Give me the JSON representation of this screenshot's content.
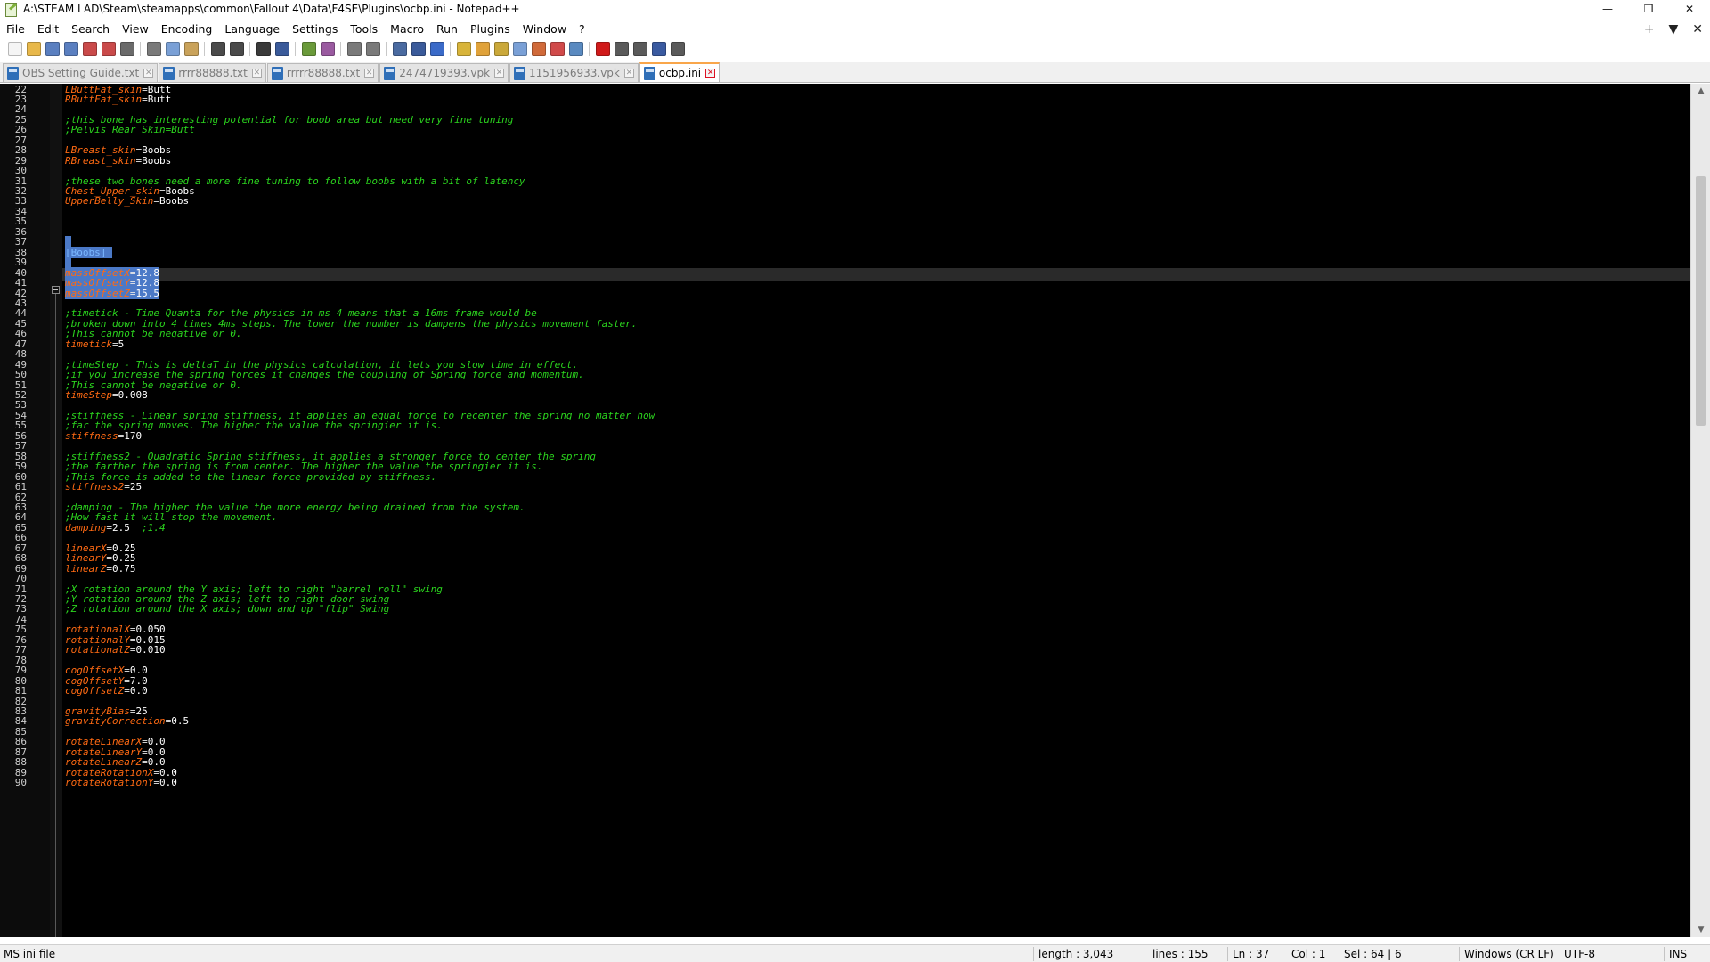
{
  "window": {
    "title": "A:\\STEAM LAD\\Steam\\steamapps\\common\\Fallout 4\\Data\\F4SE\\Plugins\\ocbp.ini - Notepad++",
    "minimize": "—",
    "maximize": "❐",
    "close": "✕"
  },
  "menu": {
    "items": [
      "File",
      "Edit",
      "Search",
      "View",
      "Encoding",
      "Language",
      "Settings",
      "Tools",
      "Macro",
      "Run",
      "Plugins",
      "Window",
      "?"
    ],
    "plus": "+",
    "dropdown": "▼",
    "close": "✕"
  },
  "toolbar": {
    "buttons": [
      {
        "name": "new-file-icon",
        "color": "#f5f5f5"
      },
      {
        "name": "open-file-icon",
        "color": "#e8b84a"
      },
      {
        "name": "save-icon",
        "color": "#5a7fc0"
      },
      {
        "name": "save-all-icon",
        "color": "#5a7fc0"
      },
      {
        "name": "close-icon",
        "color": "#c94a4a"
      },
      {
        "name": "close-all-icon",
        "color": "#c94a4a"
      },
      {
        "name": "print-icon",
        "color": "#6a6a6a"
      },
      {
        "name": "sep"
      },
      {
        "name": "cut-icon",
        "color": "#7a7a7a"
      },
      {
        "name": "copy-icon",
        "color": "#7aa0d6"
      },
      {
        "name": "paste-icon",
        "color": "#c9a25a"
      },
      {
        "name": "sep"
      },
      {
        "name": "undo-icon",
        "color": "#4a4a4a"
      },
      {
        "name": "redo-icon",
        "color": "#4a4a4a"
      },
      {
        "name": "sep"
      },
      {
        "name": "find-icon",
        "color": "#3a3a3a"
      },
      {
        "name": "replace-icon",
        "color": "#3a5a9a"
      },
      {
        "name": "sep"
      },
      {
        "name": "zoom-in-icon",
        "color": "#6a9a3a"
      },
      {
        "name": "zoom-out-icon",
        "color": "#9a5aa0"
      },
      {
        "name": "sep"
      },
      {
        "name": "sync-vertical-icon",
        "color": "#7a7a7a"
      },
      {
        "name": "sync-horizontal-icon",
        "color": "#7a7a7a"
      },
      {
        "name": "sep"
      },
      {
        "name": "word-wrap-icon",
        "color": "#4a6aa0"
      },
      {
        "name": "show-all-chars-icon",
        "color": "#3a5a9a"
      },
      {
        "name": "indent-guide-icon",
        "color": "#3a6ac8"
      },
      {
        "name": "sep"
      },
      {
        "name": "udl-icon",
        "color": "#d8b43a"
      },
      {
        "name": "doc-map-icon",
        "color": "#e0a23a"
      },
      {
        "name": "function-list-icon",
        "color": "#caa83a"
      },
      {
        "name": "folder-workspace-icon",
        "color": "#7aa0d6"
      },
      {
        "name": "doc-list-icon",
        "color": "#d06a3a"
      },
      {
        "name": "monitoring-icon",
        "color": "#d04a4a"
      },
      {
        "name": "preview-icon",
        "color": "#5a8ac0"
      },
      {
        "name": "sep"
      },
      {
        "name": "record-macro-icon",
        "color": "#d01a1a"
      },
      {
        "name": "stop-record-icon",
        "color": "#5a5a5a"
      },
      {
        "name": "play-macro-icon",
        "color": "#5a5a5a"
      },
      {
        "name": "run-macro-multiple-icon",
        "color": "#3a5aa0"
      },
      {
        "name": "save-macro-icon",
        "color": "#5a5a5a"
      }
    ]
  },
  "tabs": [
    {
      "label": "OBS Setting Guide.txt",
      "active": false
    },
    {
      "label": "rrrr88888.txt",
      "active": false
    },
    {
      "label": "rrrrr88888.txt",
      "active": false
    },
    {
      "label": "2474719393.vpk",
      "active": false
    },
    {
      "label": "1151956933.vpk",
      "active": false
    },
    {
      "label": "ocbp.ini",
      "active": true
    }
  ],
  "tab_close": "✕",
  "editor": {
    "lines": [
      {
        "n": "22",
        "t": "kv",
        "k": "LButtFat_skin",
        "v": "Butt"
      },
      {
        "n": "23",
        "t": "kv",
        "k": "RButtFat_skin",
        "v": "Butt"
      },
      {
        "n": "24",
        "t": "blank"
      },
      {
        "n": "25",
        "t": "cmt",
        "c": ";this bone has interesting potential for boob area but need very fine tuning"
      },
      {
        "n": "26",
        "t": "cmt",
        "c": ";Pelvis_Rear_Skin=Butt"
      },
      {
        "n": "27",
        "t": "blank"
      },
      {
        "n": "28",
        "t": "kv",
        "k": "LBreast_skin",
        "v": "Boobs"
      },
      {
        "n": "29",
        "t": "kv",
        "k": "RBreast_skin",
        "v": "Boobs"
      },
      {
        "n": "30",
        "t": "blank"
      },
      {
        "n": "31",
        "t": "cmt",
        "c": ";these two bones need a more fine tuning to follow boobs with a bit of latency"
      },
      {
        "n": "32",
        "t": "kv",
        "k": "Chest_Upper_skin",
        "v": "Boobs"
      },
      {
        "n": "33",
        "t": "kv",
        "k": "UpperBelly_Skin",
        "v": "Boobs"
      },
      {
        "n": "34",
        "t": "blank"
      },
      {
        "n": "35",
        "t": "blank"
      },
      {
        "n": "36",
        "t": "blank"
      },
      {
        "n": "37",
        "t": "selblank"
      },
      {
        "n": "38",
        "t": "sec",
        "c": "[Boobs]"
      },
      {
        "n": "39",
        "t": "selblank"
      },
      {
        "n": "40",
        "t": "selkv",
        "k": "massOffsetX",
        "v": "12.8"
      },
      {
        "n": "41",
        "t": "selkv",
        "k": "massOffsetY",
        "v": "12.8"
      },
      {
        "n": "42",
        "t": "selkv",
        "k": "massOffsetZ",
        "v": "15.5"
      },
      {
        "n": "43",
        "t": "blank"
      },
      {
        "n": "44",
        "t": "cmt",
        "c": ";timetick - Time Quanta for the physics in ms 4 means that a 16ms frame would be"
      },
      {
        "n": "45",
        "t": "cmt",
        "c": ";broken down into 4 times 4ms steps. The lower the number is dampens the physics movement faster."
      },
      {
        "n": "46",
        "t": "cmt",
        "c": ";This cannot be negative or 0."
      },
      {
        "n": "47",
        "t": "kv",
        "k": "timetick",
        "v": "5"
      },
      {
        "n": "48",
        "t": "blank"
      },
      {
        "n": "49",
        "t": "cmt",
        "c": ";timeStep - This is deltaT in the physics calculation, it lets you slow time in effect."
      },
      {
        "n": "50",
        "t": "cmt",
        "c": ";if you increase the spring forces it changes the coupling of Spring force and momentum."
      },
      {
        "n": "51",
        "t": "cmt",
        "c": ";This cannot be negative or 0."
      },
      {
        "n": "52",
        "t": "kv",
        "k": "timeStep",
        "v": "0.008"
      },
      {
        "n": "53",
        "t": "blank"
      },
      {
        "n": "54",
        "t": "cmt",
        "c": ";stiffness - Linear spring stiffness, it applies an equal force to recenter the spring no matter how"
      },
      {
        "n": "55",
        "t": "cmt",
        "c": ";far the spring moves. The higher the value the springier it is."
      },
      {
        "n": "56",
        "t": "kv",
        "k": "stiffness",
        "v": "170"
      },
      {
        "n": "57",
        "t": "blank"
      },
      {
        "n": "58",
        "t": "cmt",
        "c": ";stiffness2 - Quadratic Spring stiffness, it applies a stronger force to center the spring"
      },
      {
        "n": "59",
        "t": "cmt",
        "c": ";the farther the spring is from center. The higher the value the springier it is."
      },
      {
        "n": "60",
        "t": "cmt",
        "c": ";This force is added to the linear force provided by stiffness."
      },
      {
        "n": "61",
        "t": "kv",
        "k": "stiffness2",
        "v": "25"
      },
      {
        "n": "62",
        "t": "blank"
      },
      {
        "n": "63",
        "t": "cmt",
        "c": ";damping - The higher the value the more energy being drained from the system."
      },
      {
        "n": "64",
        "t": "cmt",
        "c": ";How fast it will stop the movement."
      },
      {
        "n": "65",
        "t": "kvc",
        "k": "damping",
        "v": "2.5  ",
        "c": ";1.4"
      },
      {
        "n": "66",
        "t": "blank"
      },
      {
        "n": "67",
        "t": "kv",
        "k": "linearX",
        "v": "0.25"
      },
      {
        "n": "68",
        "t": "kv",
        "k": "linearY",
        "v": "0.25"
      },
      {
        "n": "69",
        "t": "kv",
        "k": "linearZ",
        "v": "0.75"
      },
      {
        "n": "70",
        "t": "blank"
      },
      {
        "n": "71",
        "t": "cmt",
        "c": ";X rotation around the Y axis; left to right \"barrel roll\" swing"
      },
      {
        "n": "72",
        "t": "cmt",
        "c": ";Y rotation around the Z axis; left to right door swing"
      },
      {
        "n": "73",
        "t": "cmt",
        "c": ";Z rotation around the X axis; down and up \"flip\" Swing"
      },
      {
        "n": "74",
        "t": "blank"
      },
      {
        "n": "75",
        "t": "kv",
        "k": "rotationalX",
        "v": "0.050"
      },
      {
        "n": "76",
        "t": "kv",
        "k": "rotationalY",
        "v": "0.015"
      },
      {
        "n": "77",
        "t": "kv",
        "k": "rotationalZ",
        "v": "0.010"
      },
      {
        "n": "78",
        "t": "blank"
      },
      {
        "n": "79",
        "t": "kv",
        "k": "cogOffsetX",
        "v": "0.0"
      },
      {
        "n": "80",
        "t": "kv",
        "k": "cogOffsetY",
        "v": "7.0"
      },
      {
        "n": "81",
        "t": "kv",
        "k": "cogOffsetZ",
        "v": "0.0"
      },
      {
        "n": "82",
        "t": "blank"
      },
      {
        "n": "83",
        "t": "kv",
        "k": "gravityBias",
        "v": "25"
      },
      {
        "n": "84",
        "t": "kv",
        "k": "gravityCorrection",
        "v": "0.5"
      },
      {
        "n": "85",
        "t": "blank"
      },
      {
        "n": "86",
        "t": "kv",
        "k": "rotateLinearX",
        "v": "0.0"
      },
      {
        "n": "87",
        "t": "kv",
        "k": "rotateLinearY",
        "v": "0.0"
      },
      {
        "n": "88",
        "t": "kv",
        "k": "rotateLinearZ",
        "v": "0.0"
      },
      {
        "n": "89",
        "t": "kv",
        "k": "rotateRotationX",
        "v": "0.0"
      },
      {
        "n": "90",
        "t": "kv",
        "k": "rotateRotationY",
        "v": "0.0"
      }
    ]
  },
  "status": {
    "filetype": "MS ini file",
    "length": "length : 3,043",
    "lines": "lines : 155",
    "ln": "Ln : 37",
    "col": "Col : 1",
    "sel": "Sel : 64 | 6",
    "eol": "Windows (CR LF)",
    "encoding": "UTF-8",
    "mode": "INS"
  }
}
